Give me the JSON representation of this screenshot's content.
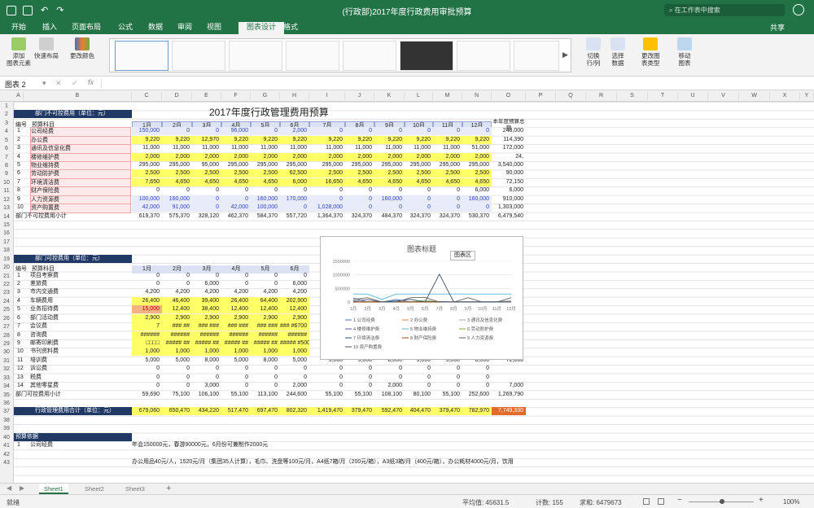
{
  "window": {
    "title": "(行政部)2017年度行政费用审批预算",
    "search_placeholder": "在工作表中搜索"
  },
  "tabs": [
    "开始",
    "插入",
    "页面布局",
    "公式",
    "数据",
    "审阅",
    "视图",
    "图表设计",
    "格式"
  ],
  "share_label": "共享",
  "ribbon": {
    "add_element": "添加\n图表元素",
    "quick_layout": "快速布局",
    "change_colors": "更改颜色",
    "switch": "切换\n行/列",
    "select_data": "选择\n数据",
    "change_type": "更改图\n表类型",
    "move_chart": "移动\n图表"
  },
  "formula_bar": {
    "name_box": "图表 2",
    "fx": "fx"
  },
  "columns": [
    "A",
    "B",
    "C",
    "D",
    "E",
    "F",
    "G",
    "H",
    "I",
    "J",
    "K",
    "L",
    "M",
    "N",
    "O",
    "P",
    "Q",
    "R",
    "S",
    "T",
    "U",
    "V",
    "W",
    "X",
    "Y"
  ],
  "rows": [
    "1",
    "2",
    "3",
    "4",
    "5",
    "6",
    "7",
    "8",
    "9",
    "10",
    "11",
    "12",
    "13",
    "14",
    "15",
    "16",
    "17",
    "18",
    "19",
    "20",
    "21",
    "22",
    "23",
    "24",
    "25",
    "26",
    "27",
    "28",
    "29",
    "30",
    "31",
    "32",
    "33",
    "34",
    "35",
    "36",
    "37",
    "38",
    "39",
    "40",
    "41",
    "42",
    "43"
  ],
  "sheet": {
    "title": "2017年度行政管理费用预算",
    "section1": "部门不可控费用（单位：元）",
    "h_no": "编号",
    "h_item": "预算科目",
    "months": [
      "1月",
      "2月",
      "3月",
      "4月",
      "5月",
      "6月",
      "7月",
      "8月",
      "9月",
      "10月",
      "11月",
      "12月"
    ],
    "h_total": "本年度预算总额",
    "t1": [
      {
        "n": "1",
        "i": "公司经费",
        "v": [
          "150,000",
          "0",
          "0",
          "96,000",
          "0",
          "2,000",
          "0",
          "0",
          "0",
          "0",
          "0",
          "0",
          "248,000"
        ]
      },
      {
        "n": "2",
        "i": "办公费",
        "v": [
          "9,220",
          "9,220",
          "12,970",
          "9,220",
          "9,220",
          "9,220",
          "9,220",
          "9,220",
          "9,220",
          "9,220",
          "9,220",
          "9,220",
          "114,390"
        ]
      },
      {
        "n": "3",
        "i": "通讯及信息化费",
        "v": [
          "11,000",
          "11,000",
          "11,000",
          "11,000",
          "11,000",
          "11,000",
          "11,000",
          "11,000",
          "11,000",
          "11,000",
          "11,000",
          "51,000",
          "172,000"
        ]
      },
      {
        "n": "4",
        "i": "楼修维护费",
        "v": [
          "2,000",
          "2,000",
          "2,000",
          "2,000",
          "2,000",
          "2,000",
          "2,000",
          "2,000",
          "2,000",
          "2,000",
          "2,000",
          "2,000",
          "24,"
        ]
      },
      {
        "n": "5",
        "i": "物业维持费",
        "v": [
          "295,000",
          "295,000",
          "95,000",
          "295,000",
          "295,000",
          "295,000",
          "295,000",
          "295,000",
          "295,000",
          "295,000",
          "295,000",
          "295,000",
          "3,540,000"
        ]
      },
      {
        "n": "6",
        "i": "劳动防护费",
        "v": [
          "2,500",
          "2,500",
          "2,500",
          "2,500",
          "2,500",
          "62,500",
          "2,500",
          "2,500",
          "2,500",
          "2,500",
          "2,500",
          "2,500",
          "90,000"
        ]
      },
      {
        "n": "7",
        "i": "环境清洁费",
        "v": [
          "7,650",
          "4,650",
          "4,650",
          "4,650",
          "4,650",
          "6,000",
          "16,650",
          "4,650",
          "4,650",
          "4,650",
          "4,650",
          "4,650",
          "72,150"
        ]
      },
      {
        "n": "8",
        "i": "财产保险费",
        "v": [
          "0",
          "0",
          "0",
          "0",
          "0",
          "0",
          "0",
          "0",
          "0",
          "0",
          "0",
          "6,000",
          "6,000"
        ]
      },
      {
        "n": "9",
        "i": "人力资源费",
        "v": [
          "100,000",
          "160,000",
          "0",
          "0",
          "160,000",
          "170,000",
          "0",
          "0",
          "160,000",
          "0",
          "0",
          "160,000",
          "910,000"
        ]
      },
      {
        "n": "10",
        "i": "资产购置费",
        "v": [
          "42,000",
          "91,000",
          "0",
          "42,000",
          "100,000",
          "0",
          "1,028,000",
          "0",
          "0",
          "0",
          "0",
          "0",
          "1,303,000"
        ]
      }
    ],
    "subtotal1": {
      "label": "部门不可控费用小计",
      "v": [
        "619,370",
        "575,370",
        "328,120",
        "462,370",
        "584,370",
        "557,720",
        "1,364,370",
        "324,370",
        "484,370",
        "324,370",
        "324,370",
        "530,370",
        "6,479,540"
      ]
    },
    "section2": "部门可控费用（单位：元）",
    "t2": [
      {
        "n": "1",
        "i": "项目考察费",
        "v": [
          "0",
          "0",
          "0",
          "0",
          "0",
          "0"
        ]
      },
      {
        "n": "2",
        "i": "差旅费",
        "v": [
          "0",
          "0",
          "6,000",
          "0",
          "0",
          "6,000"
        ]
      },
      {
        "n": "3",
        "i": "市内交通费",
        "v": [
          "4,200",
          "4,200",
          "4,200",
          "4,200",
          "4,200",
          "4,200"
        ]
      },
      {
        "n": "4",
        "i": "车辆费用",
        "v": [
          "26,400",
          "46,400",
          "39,400",
          "26,400",
          "64,400",
          "202,900"
        ]
      },
      {
        "n": "5",
        "i": "业务招待费",
        "v": [
          "15,000",
          "12,400",
          "38,400",
          "12,400",
          "12,400",
          "12,400"
        ]
      },
      {
        "n": "6",
        "i": "部门活动费",
        "v": [
          "2,900",
          "2,900",
          "2,900",
          "2,900",
          "2,900",
          "2,900"
        ]
      },
      {
        "n": "7",
        "i": "会议费",
        "v": [
          "7",
          "### ##",
          "### ###",
          "### ###",
          "### ###",
          "### #6700"
        ]
      },
      {
        "n": "8",
        "i": "咨询费",
        "v": [
          "######",
          "######",
          "######",
          "######",
          "######",
          "######"
        ]
      },
      {
        "n": "9",
        "i": "邮寄印刷费",
        "v": [
          "□□□□",
          "##### ##",
          "##### ##",
          "##### ##",
          "##### ##",
          "##### #500"
        ]
      },
      {
        "n": "10",
        "i": "书刊资料费",
        "v": [
          "1,000",
          "1,000",
          "1,000",
          "1,000",
          "1,000",
          "1,000"
        ]
      },
      {
        "n": "11",
        "i": "培训费",
        "v": [
          "5,000",
          "5,000",
          "8,000",
          "5,000",
          "8,000",
          "5,000",
          "5,000",
          "5,000",
          "8,000",
          "5,000",
          "5,000",
          "8,000",
          "72,000"
        ]
      },
      {
        "n": "12",
        "i": "诉讼费",
        "v": [
          "0",
          "0",
          "0",
          "0",
          "0",
          "0",
          "0",
          "0",
          "0",
          "0",
          "0",
          "0",
          ""
        ]
      },
      {
        "n": "13",
        "i": "税费",
        "v": [
          "0",
          "0",
          "0",
          "0",
          "0",
          "0",
          "0",
          "0",
          "0",
          "0",
          "0",
          "0",
          ""
        ]
      },
      {
        "n": "14",
        "i": "其他零星费",
        "v": [
          "0",
          "0",
          "3,000",
          "0",
          "0",
          "2,000",
          "0",
          "0",
          "2,000",
          "0",
          "0",
          "0",
          "7,000"
        ]
      }
    ],
    "subtotal2": {
      "label": "部门可控费用小计",
      "v": [
        "59,690",
        "75,100",
        "106,100",
        "55,100",
        "113,100",
        "244,600",
        "55,100",
        "55,100",
        "108,100",
        "80,100",
        "55,100",
        "252,600",
        "1,269,790"
      ]
    },
    "grand": {
      "label": "行政管理费用合计（单位：元）",
      "v": [
        "679,060",
        "650,470",
        "434,220",
        "517,470",
        "697,470",
        "802,320",
        "1,419,470",
        "379,470",
        "592,470",
        "404,470",
        "379,470",
        "782,970",
        "7,749,330"
      ]
    },
    "notes_title": "预算依据",
    "note1_no": "1",
    "note1_item": "公司经费",
    "note1_text": "年会150000元，春游90000元，6月份可兼制作2000元",
    "note2_text": "办公用品40元/人，1520元/月（集团35人计算），毛巾、洗盘等100元/月，A4纸7箱/月（200元/箱），A3纸3箱/月（400元/箱），办公耗材4000元/月，饮用"
  },
  "chart": {
    "title": "图表标题",
    "tooltip": "图表区",
    "y_ticks": [
      "1500000",
      "1000000",
      "500000",
      "0"
    ],
    "legend": [
      "1 公司经费",
      "2 办公费",
      "3 通讯及信息化费",
      "4 楼修维护费",
      "5 物业维持费",
      "6 劳动防护费",
      "7 环境清洁费",
      "8 财产保险费",
      "9 人力资源费",
      "10 资产购置费"
    ],
    "colors": [
      "#4472c4",
      "#ed7d31",
      "#a5a5a5",
      "#5b5ea6",
      "#5ab4d6",
      "#70ad47",
      "#264478",
      "#9e480e",
      "#636363",
      "#44546a"
    ]
  },
  "chart_data": {
    "type": "line",
    "title": "图表标题",
    "categories": [
      "1月",
      "2月",
      "3月",
      "4月",
      "5月",
      "6月",
      "7月",
      "8月",
      "9月",
      "10月",
      "11月",
      "12月"
    ],
    "ylim": [
      0,
      1500000
    ],
    "series": [
      {
        "name": "1 公司经费",
        "values": [
          150000,
          0,
          0,
          96000,
          0,
          2000,
          0,
          0,
          0,
          0,
          0,
          0
        ]
      },
      {
        "name": "2 办公费",
        "values": [
          9220,
          9220,
          12970,
          9220,
          9220,
          9220,
          9220,
          9220,
          9220,
          9220,
          9220,
          9220
        ]
      },
      {
        "name": "3 通讯及信息化费",
        "values": [
          11000,
          11000,
          11000,
          11000,
          11000,
          11000,
          11000,
          11000,
          11000,
          11000,
          11000,
          51000
        ]
      },
      {
        "name": "4 楼修维护费",
        "values": [
          2000,
          2000,
          2000,
          2000,
          2000,
          2000,
          2000,
          2000,
          2000,
          2000,
          2000,
          2000
        ]
      },
      {
        "name": "5 物业维持费",
        "values": [
          295000,
          295000,
          95000,
          295000,
          295000,
          295000,
          295000,
          295000,
          295000,
          295000,
          295000,
          295000
        ]
      },
      {
        "name": "6 劳动防护费",
        "values": [
          2500,
          2500,
          2500,
          2500,
          2500,
          62500,
          2500,
          2500,
          2500,
          2500,
          2500,
          2500
        ]
      },
      {
        "name": "7 环境清洁费",
        "values": [
          7650,
          4650,
          4650,
          4650,
          4650,
          6000,
          16650,
          4650,
          4650,
          4650,
          4650,
          4650
        ]
      },
      {
        "name": "8 财产保险费",
        "values": [
          0,
          0,
          0,
          0,
          0,
          0,
          0,
          0,
          0,
          0,
          0,
          6000
        ]
      },
      {
        "name": "9 人力资源费",
        "values": [
          100000,
          160000,
          0,
          0,
          160000,
          170000,
          0,
          0,
          160000,
          0,
          0,
          160000
        ]
      },
      {
        "name": "10 资产购置费",
        "values": [
          42000,
          91000,
          0,
          42000,
          100000,
          0,
          1028000,
          0,
          0,
          0,
          0,
          0
        ]
      }
    ]
  },
  "sheets": [
    "Sheet1",
    "Sheet2",
    "Sheet3"
  ],
  "status": {
    "ready": "就绪",
    "avg": "平均值: 45631.5",
    "count": "计数: 155",
    "sum": "求和: 6479673",
    "zoom": "100%"
  }
}
